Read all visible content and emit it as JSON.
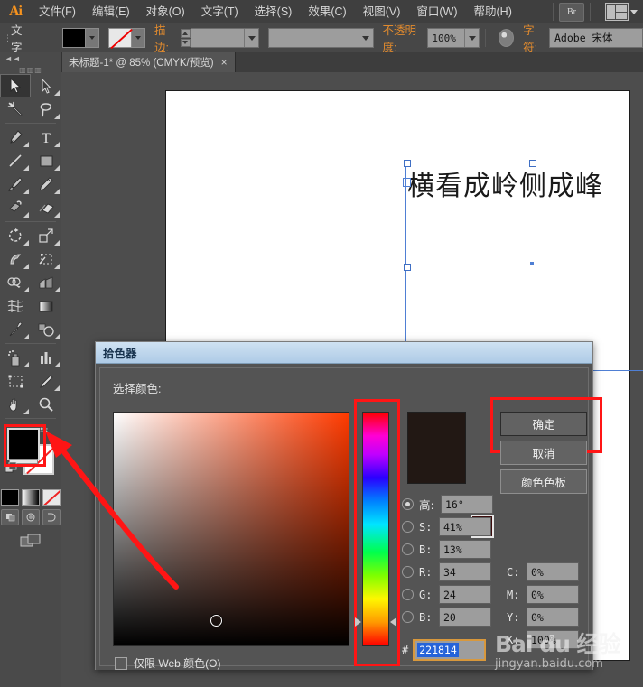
{
  "app": {
    "logo": "Ai",
    "accent_orange": "#e08a2e",
    "annotation_red": "#ff1515"
  },
  "menubar": {
    "items": [
      {
        "label": "文件(F)"
      },
      {
        "label": "编辑(E)"
      },
      {
        "label": "对象(O)"
      },
      {
        "label": "文字(T)"
      },
      {
        "label": "选择(S)"
      },
      {
        "label": "效果(C)"
      },
      {
        "label": "视图(V)"
      },
      {
        "label": "窗口(W)"
      },
      {
        "label": "帮助(H)"
      }
    ],
    "bridge_button": "Br"
  },
  "controlbar": {
    "tool_label": "文字",
    "stroke_label": "描边:",
    "stroke_weight": "",
    "stroke_profile": "",
    "opacity_label": "不透明度:",
    "opacity_value": "100%",
    "char_label": "字符:",
    "font_name": "Adobe 宋体"
  },
  "tabbar": {
    "document_tab": "未标题-1* @ 85% (CMYK/预览)",
    "close_glyph": "×"
  },
  "toolbar": {
    "collapse_glyph": "◄◄",
    "grip_glyph": "▥",
    "tools": [
      {
        "name": "selection-tool",
        "selected": true
      },
      {
        "name": "direct-selection-tool",
        "selected": false
      },
      {
        "name": "magic-wand-tool",
        "selected": false
      },
      {
        "name": "lasso-tool",
        "selected": false
      },
      {
        "name": "pen-tool",
        "selected": false
      },
      {
        "name": "type-tool",
        "selected": false
      },
      {
        "name": "line-segment-tool",
        "selected": false
      },
      {
        "name": "rectangle-tool",
        "selected": false
      },
      {
        "name": "paintbrush-tool",
        "selected": false
      },
      {
        "name": "pencil-tool",
        "selected": false
      },
      {
        "name": "blob-brush-tool",
        "selected": false
      },
      {
        "name": "eraser-tool",
        "selected": false
      },
      {
        "name": "rotate-tool",
        "selected": false
      },
      {
        "name": "scale-tool",
        "selected": false
      },
      {
        "name": "warp-tool",
        "selected": false
      },
      {
        "name": "free-transform-tool",
        "selected": false
      },
      {
        "name": "shape-builder-tool",
        "selected": false
      },
      {
        "name": "perspective-grid-tool",
        "selected": false
      },
      {
        "name": "mesh-tool",
        "selected": false
      },
      {
        "name": "gradient-tool",
        "selected": false
      },
      {
        "name": "eyedropper-tool",
        "selected": false
      },
      {
        "name": "blend-tool",
        "selected": false
      },
      {
        "name": "symbol-sprayer-tool",
        "selected": false
      },
      {
        "name": "column-graph-tool",
        "selected": false
      },
      {
        "name": "artboard-tool",
        "selected": false
      },
      {
        "name": "slice-tool",
        "selected": false
      },
      {
        "name": "hand-tool",
        "selected": false
      },
      {
        "name": "zoom-tool",
        "selected": false
      }
    ],
    "fill_color": "#000000",
    "stroke_color": "none",
    "screen_mode": "change-screen-mode"
  },
  "canvas": {
    "text_object": "横看成岭侧成峰",
    "artboard_bg": "#ffffff",
    "selection_color": "#4f7fd4"
  },
  "dialog": {
    "title": "拾色器",
    "prompt": "选择颜色:",
    "preview_color": "#221814",
    "previous_color": "#3c0c0c",
    "buttons": [
      {
        "name": "ok",
        "label": "确定"
      },
      {
        "name": "cancel",
        "label": "取消"
      },
      {
        "name": "color-swatches",
        "label": "颜色色板"
      }
    ],
    "fields": [
      {
        "name": "hue",
        "label": "高:",
        "value": "16°",
        "selected": true
      },
      {
        "name": "saturation",
        "label": "S:",
        "value": "41%",
        "selected": false
      },
      {
        "name": "brightness",
        "label": "B:",
        "value": "13%",
        "selected": false
      },
      {
        "name": "red",
        "label": "R:",
        "value": "34",
        "selected": false
      },
      {
        "name": "green",
        "label": "G:",
        "value": "24",
        "selected": false
      },
      {
        "name": "blue",
        "label": "B:",
        "value": "20",
        "selected": false
      }
    ],
    "cmyk": [
      {
        "name": "cyan",
        "label": "C:",
        "value": "0%"
      },
      {
        "name": "magenta",
        "label": "M:",
        "value": "0%"
      },
      {
        "name": "yellow",
        "label": "Y:",
        "value": "0%"
      },
      {
        "name": "black",
        "label": "K:",
        "value": "100%"
      }
    ],
    "hex_symbol": "#",
    "hex_value": "221814",
    "web_only_checkbox": {
      "label": "仅限 Web 颜色(O)",
      "checked": false
    },
    "out_of_gamut_icon": "cube-icon"
  },
  "watermark": {
    "brand": "Bai du 经验",
    "url": "jingyan.baidu.com"
  }
}
